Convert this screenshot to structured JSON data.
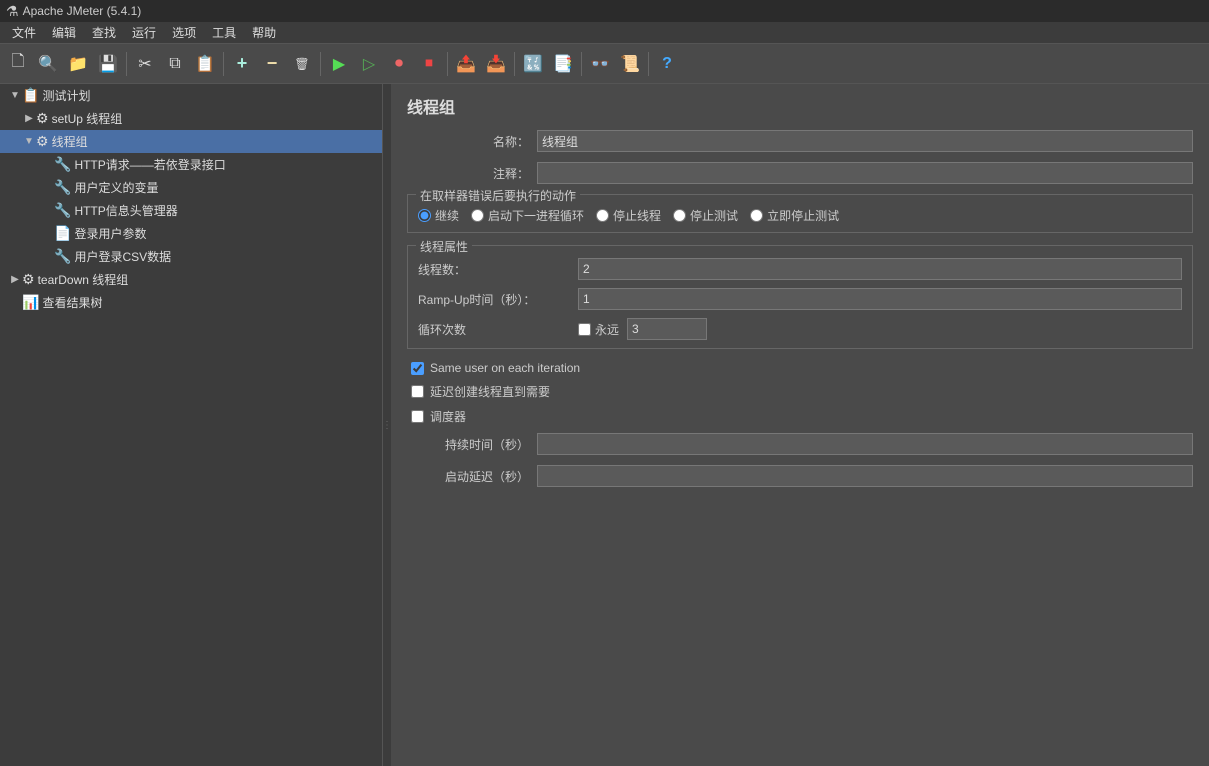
{
  "title_bar": {
    "text": "Apache JMeter (5.4.1)"
  },
  "menu": {
    "items": [
      "文件",
      "编辑",
      "查找",
      "运行",
      "选项",
      "工具",
      "帮助"
    ]
  },
  "toolbar": {
    "buttons": [
      {
        "name": "new",
        "icon": "🗋"
      },
      {
        "name": "open",
        "icon": "🔍"
      },
      {
        "name": "save-template",
        "icon": "📁"
      },
      {
        "name": "save",
        "icon": "💾"
      },
      {
        "name": "cut",
        "icon": "✂"
      },
      {
        "name": "copy",
        "icon": "📄"
      },
      {
        "name": "paste",
        "icon": "📋"
      },
      {
        "name": "add",
        "icon": "+"
      },
      {
        "name": "remove",
        "icon": "−"
      },
      {
        "name": "clear",
        "icon": "🗑"
      },
      {
        "name": "run",
        "icon": "▶"
      },
      {
        "name": "run-no-pause",
        "icon": "▷"
      },
      {
        "name": "stop-loop",
        "icon": "⏺"
      },
      {
        "name": "stop",
        "icon": "⏹"
      },
      {
        "name": "remote-start",
        "icon": "📤"
      },
      {
        "name": "remote-stop",
        "icon": "📥"
      },
      {
        "name": "remote-clear",
        "icon": "🔄"
      },
      {
        "name": "function-helper",
        "icon": "∫"
      },
      {
        "name": "help",
        "icon": "?"
      }
    ]
  },
  "tree": {
    "items": [
      {
        "id": "test-plan",
        "label": "测试计划",
        "level": 0,
        "icon": "📋",
        "expanded": true,
        "arrow": "▼"
      },
      {
        "id": "setup",
        "label": "setUp 线程组",
        "level": 1,
        "icon": "⚙",
        "expanded": false,
        "arrow": "▶"
      },
      {
        "id": "thread-group",
        "label": "线程组",
        "level": 1,
        "icon": "⚙",
        "expanded": true,
        "arrow": "▼",
        "selected": true
      },
      {
        "id": "http-request",
        "label": "HTTP请求——若依登录接口",
        "level": 2,
        "icon": "🔧",
        "arrow": ""
      },
      {
        "id": "user-vars",
        "label": "用户定义的变量",
        "level": 2,
        "icon": "🔧",
        "arrow": ""
      },
      {
        "id": "http-header",
        "label": "HTTP信息头管理器",
        "level": 2,
        "icon": "🔧",
        "arrow": ""
      },
      {
        "id": "login-params",
        "label": "登录用户参数",
        "level": 2,
        "icon": "📄",
        "arrow": ""
      },
      {
        "id": "csv-data",
        "label": "用户登录CSV数据",
        "level": 2,
        "icon": "🔧",
        "arrow": ""
      },
      {
        "id": "teardown",
        "label": "tearDown 线程组",
        "level": 0,
        "icon": "⚙",
        "expanded": false,
        "arrow": "▶"
      },
      {
        "id": "result-tree",
        "label": "查看结果树",
        "level": 0,
        "icon": "📊",
        "arrow": ""
      }
    ]
  },
  "panel": {
    "title": "线程组",
    "name_label": "名称：",
    "name_value": "线程组",
    "comment_label": "注释：",
    "comment_value": "",
    "error_section_label": "在取样器错误后要执行的动作",
    "error_actions": [
      {
        "id": "continue",
        "label": "继续",
        "checked": true
      },
      {
        "id": "start-next",
        "label": "启动下一进程循环",
        "checked": false
      },
      {
        "id": "stop-thread",
        "label": "停止线程",
        "checked": false
      },
      {
        "id": "stop-test",
        "label": "停止测试",
        "checked": false
      },
      {
        "id": "stop-now",
        "label": "立即停止测试",
        "checked": false
      }
    ],
    "thread_props_label": "线程属性",
    "threads_label": "线程数：",
    "threads_value": "2",
    "rampup_label": "Ramp-Up时间（秒）：",
    "rampup_value": "1",
    "iterations_label": "循环次数",
    "forever_label": "永远",
    "forever_checked": false,
    "iterations_value": "3",
    "same_user_label": "Same user on each iteration",
    "same_user_checked": true,
    "delay_create_label": "延迟创建线程直到需要",
    "delay_create_checked": false,
    "scheduler_label": "调度器",
    "scheduler_checked": false,
    "duration_label": "持续时间（秒）",
    "duration_value": "",
    "startup_delay_label": "启动延迟（秒）",
    "startup_delay_value": ""
  }
}
